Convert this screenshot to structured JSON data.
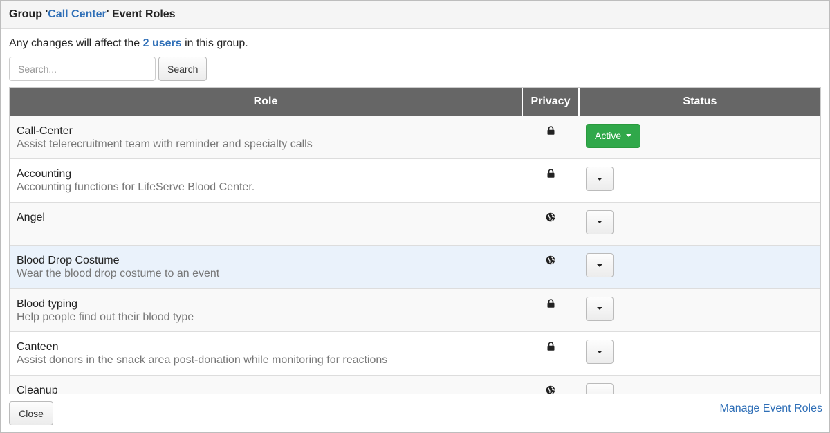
{
  "header": {
    "prefix": "Group '",
    "group_name": "Call Center",
    "suffix": "' Event Roles"
  },
  "notice": {
    "before": "Any changes will affect the ",
    "users_link": "2 users",
    "after": " in this group."
  },
  "search": {
    "placeholder": "Search...",
    "button_label": "Search"
  },
  "table": {
    "columns": [
      "Role",
      "Privacy",
      "Status"
    ],
    "rows": [
      {
        "name": "Call-Center",
        "description": "Assist telerecruitment team with reminder and specialty calls",
        "privacy": "lock-icon",
        "status": "Active"
      },
      {
        "name": "Accounting",
        "description": "Accounting functions for LifeServe Blood Center.",
        "privacy": "lock-icon",
        "status": ""
      },
      {
        "name": "Angel",
        "description": "",
        "privacy": "globe-icon",
        "status": ""
      },
      {
        "name": "Blood Drop Costume",
        "description": "Wear the blood drop costume to an event",
        "privacy": "globe-icon",
        "status": ""
      },
      {
        "name": "Blood typing",
        "description": "Help people find out their blood type",
        "privacy": "lock-icon",
        "status": ""
      },
      {
        "name": "Canteen",
        "description": "Assist donors in the snack area post-donation while monitoring for reactions",
        "privacy": "lock-icon",
        "status": ""
      },
      {
        "name": "Cleanup",
        "description": "",
        "privacy": "globe-icon",
        "status": ""
      }
    ]
  },
  "footer": {
    "close_label": "Close",
    "manage_link": "Manage Event Roles"
  },
  "colors": {
    "link": "#2f6fb7",
    "active_button": "#30a84a",
    "table_header": "#666666",
    "highlight_row": "#eaf2fb"
  }
}
